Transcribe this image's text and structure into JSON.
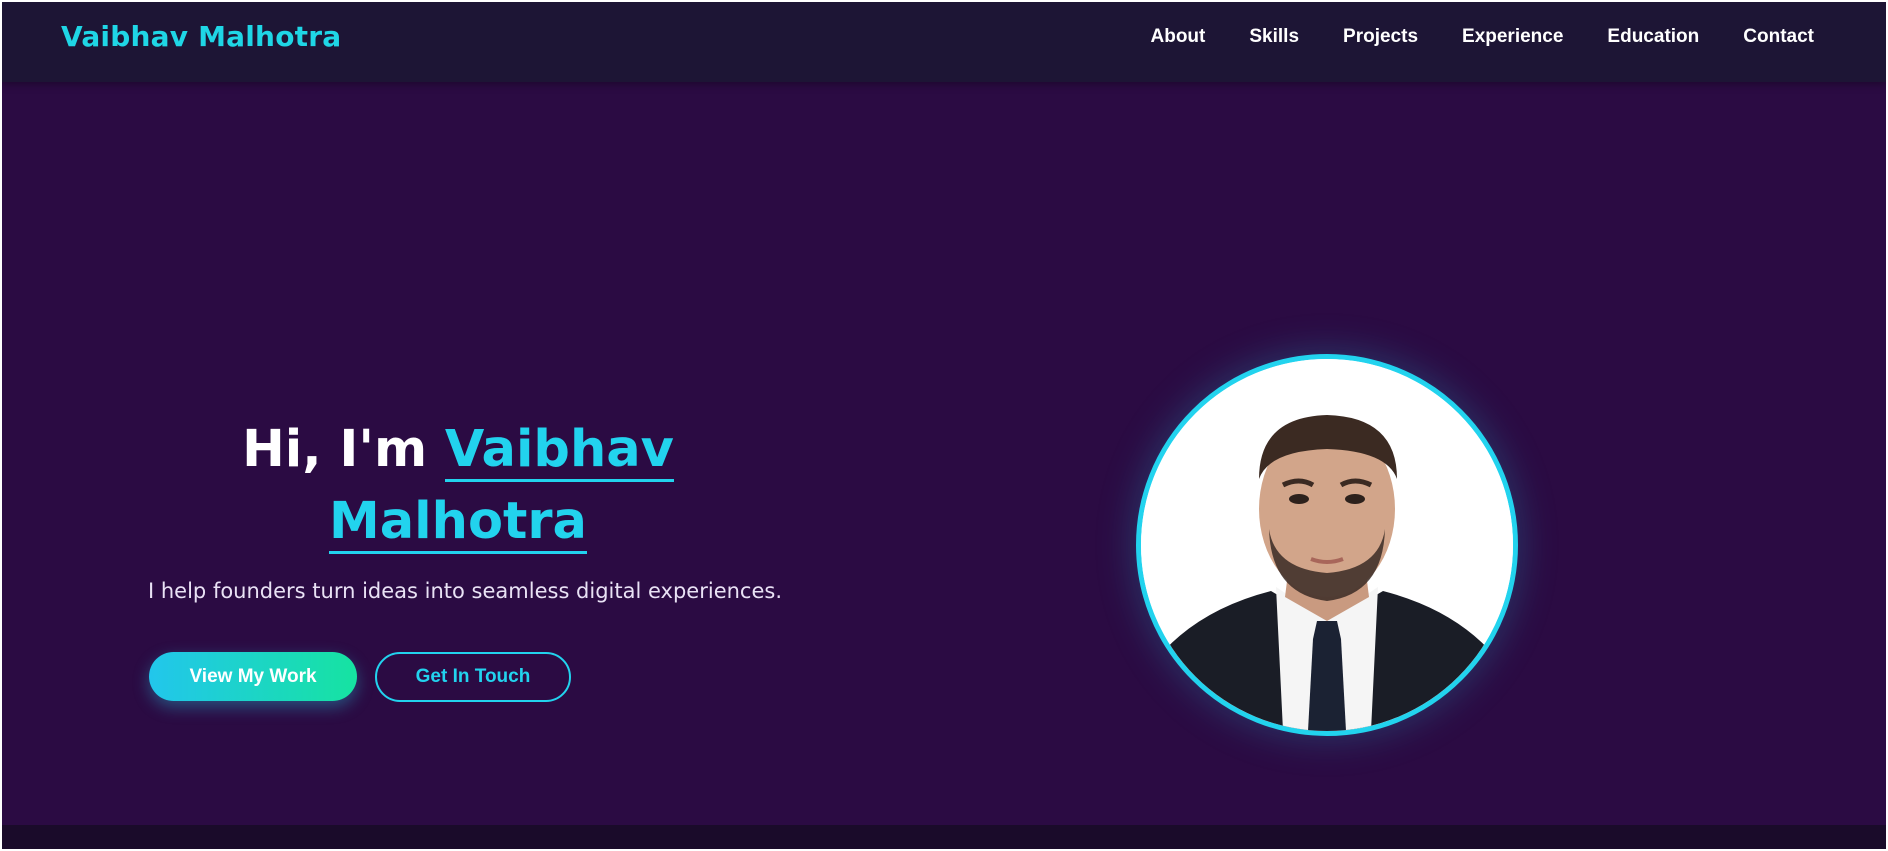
{
  "brand": {
    "name": "Vaibhav Malhotra"
  },
  "nav": {
    "items": [
      {
        "label": "About"
      },
      {
        "label": "Skills"
      },
      {
        "label": "Projects"
      },
      {
        "label": "Experience"
      },
      {
        "label": "Education"
      },
      {
        "label": "Contact"
      }
    ]
  },
  "hero": {
    "greeting": "Hi, I'm ",
    "name_first": "Vaibhav",
    "name_last": "Malhotra",
    "tagline": "I help founders turn ideas into seamless digital experiences.",
    "primary_button": "View My Work",
    "secondary_button": "Get In Touch"
  },
  "colors": {
    "background": "#2b0b43",
    "navbar": "#1d1535",
    "accent": "#22d3ee",
    "gradient_end": "#16e3a1"
  },
  "icons": {
    "profile_photo": "profile-photo"
  }
}
